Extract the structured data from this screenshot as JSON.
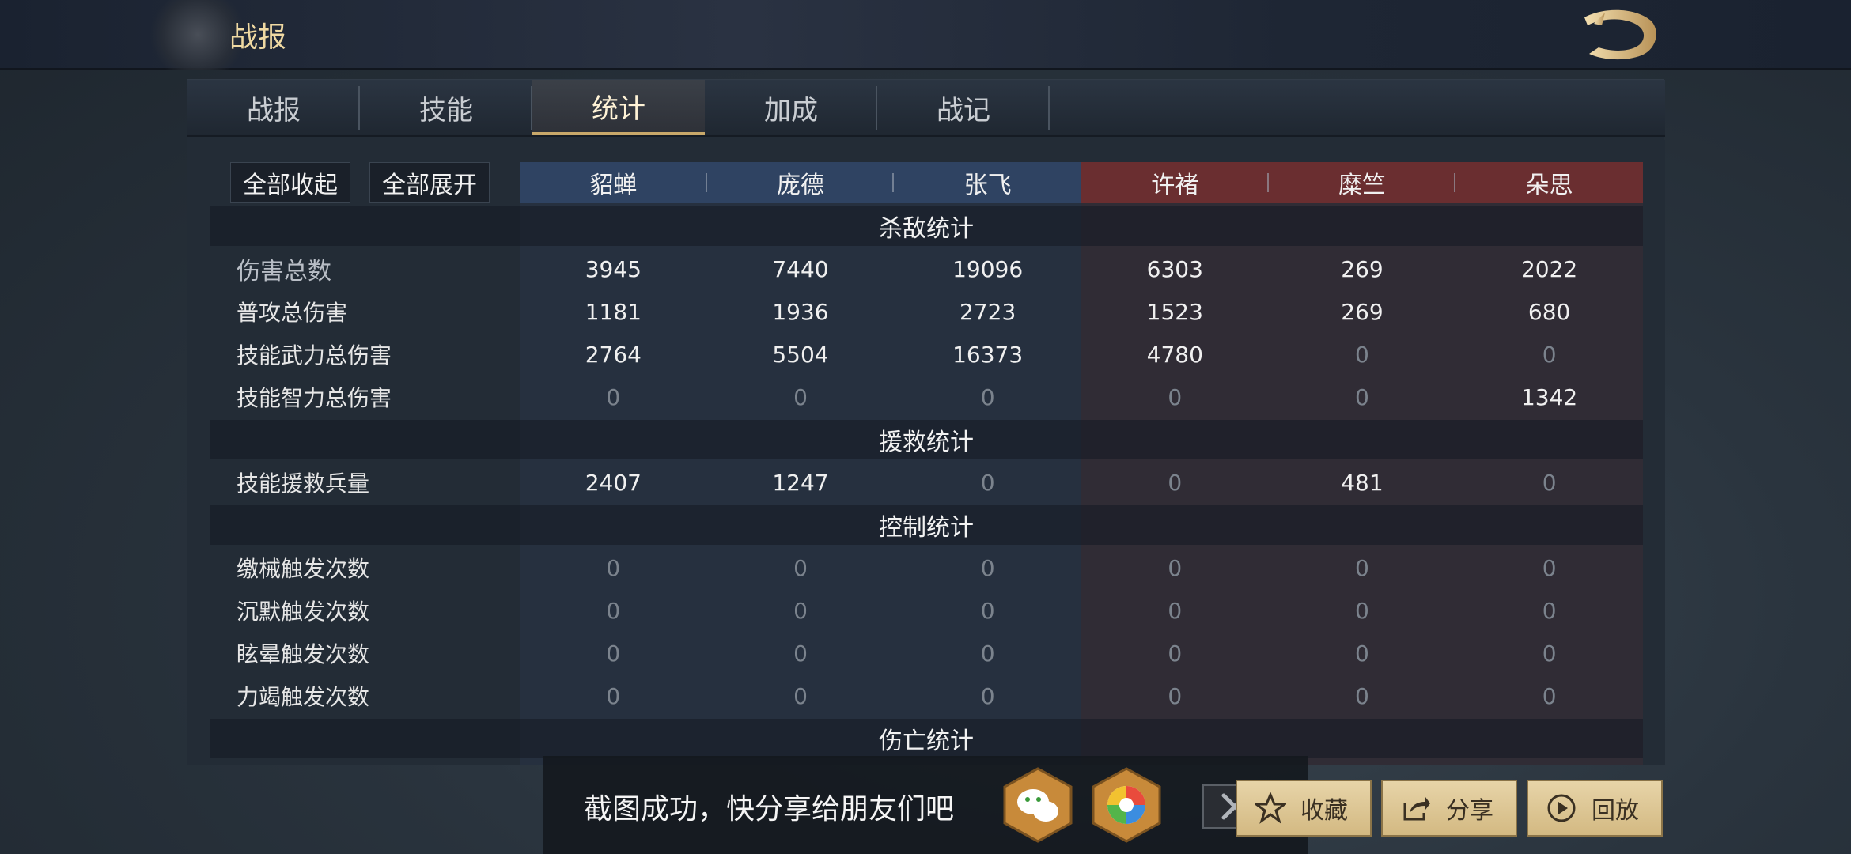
{
  "header": {
    "title": "战报"
  },
  "tabs": [
    "战报",
    "技能",
    "统计",
    "加成",
    "战记"
  ],
  "active_tab": 2,
  "controls": {
    "collapse_all": "全部收起",
    "expand_all": "全部展开"
  },
  "heroes": {
    "blue": [
      "貂蝉",
      "庞德",
      "张飞"
    ],
    "red": [
      "许褚",
      "糜竺",
      "朵思"
    ]
  },
  "colors": {
    "blue_team": "#2f4362",
    "red_team": "#6a2e30",
    "accent_gold": "#c8a86a"
  },
  "sections": [
    {
      "title": "杀敌统计",
      "rows": [
        {
          "label": "伤害总数",
          "values": [
            3945,
            7440,
            19096,
            6303,
            269,
            2022
          ]
        },
        {
          "label": "普攻总伤害",
          "values": [
            1181,
            1936,
            2723,
            1523,
            269,
            680
          ]
        },
        {
          "label": "技能武力总伤害",
          "values": [
            2764,
            5504,
            16373,
            4780,
            0,
            0
          ]
        },
        {
          "label": "技能智力总伤害",
          "values": [
            0,
            0,
            0,
            0,
            0,
            1342
          ]
        }
      ]
    },
    {
      "title": "援救统计",
      "rows": [
        {
          "label": "技能援救兵量",
          "values": [
            2407,
            1247,
            0,
            0,
            481,
            0
          ]
        }
      ]
    },
    {
      "title": "控制统计",
      "rows": [
        {
          "label": "缴械触发次数",
          "values": [
            0,
            0,
            0,
            0,
            0,
            0
          ]
        },
        {
          "label": "沉默触发次数",
          "values": [
            0,
            0,
            0,
            0,
            0,
            0
          ]
        },
        {
          "label": "眩晕触发次数",
          "values": [
            0,
            0,
            0,
            0,
            0,
            0
          ]
        },
        {
          "label": "力竭触发次数",
          "values": [
            0,
            0,
            0,
            0,
            0,
            0
          ]
        }
      ]
    },
    {
      "title": "伤亡统计",
      "rows": []
    }
  ],
  "share": {
    "message": "截图成功，快分享给朋友们吧",
    "icons": [
      "wechat-icon",
      "moments-icon",
      "close-icon"
    ]
  },
  "actions": {
    "favorite": "收藏",
    "share": "分享",
    "replay": "回放"
  }
}
